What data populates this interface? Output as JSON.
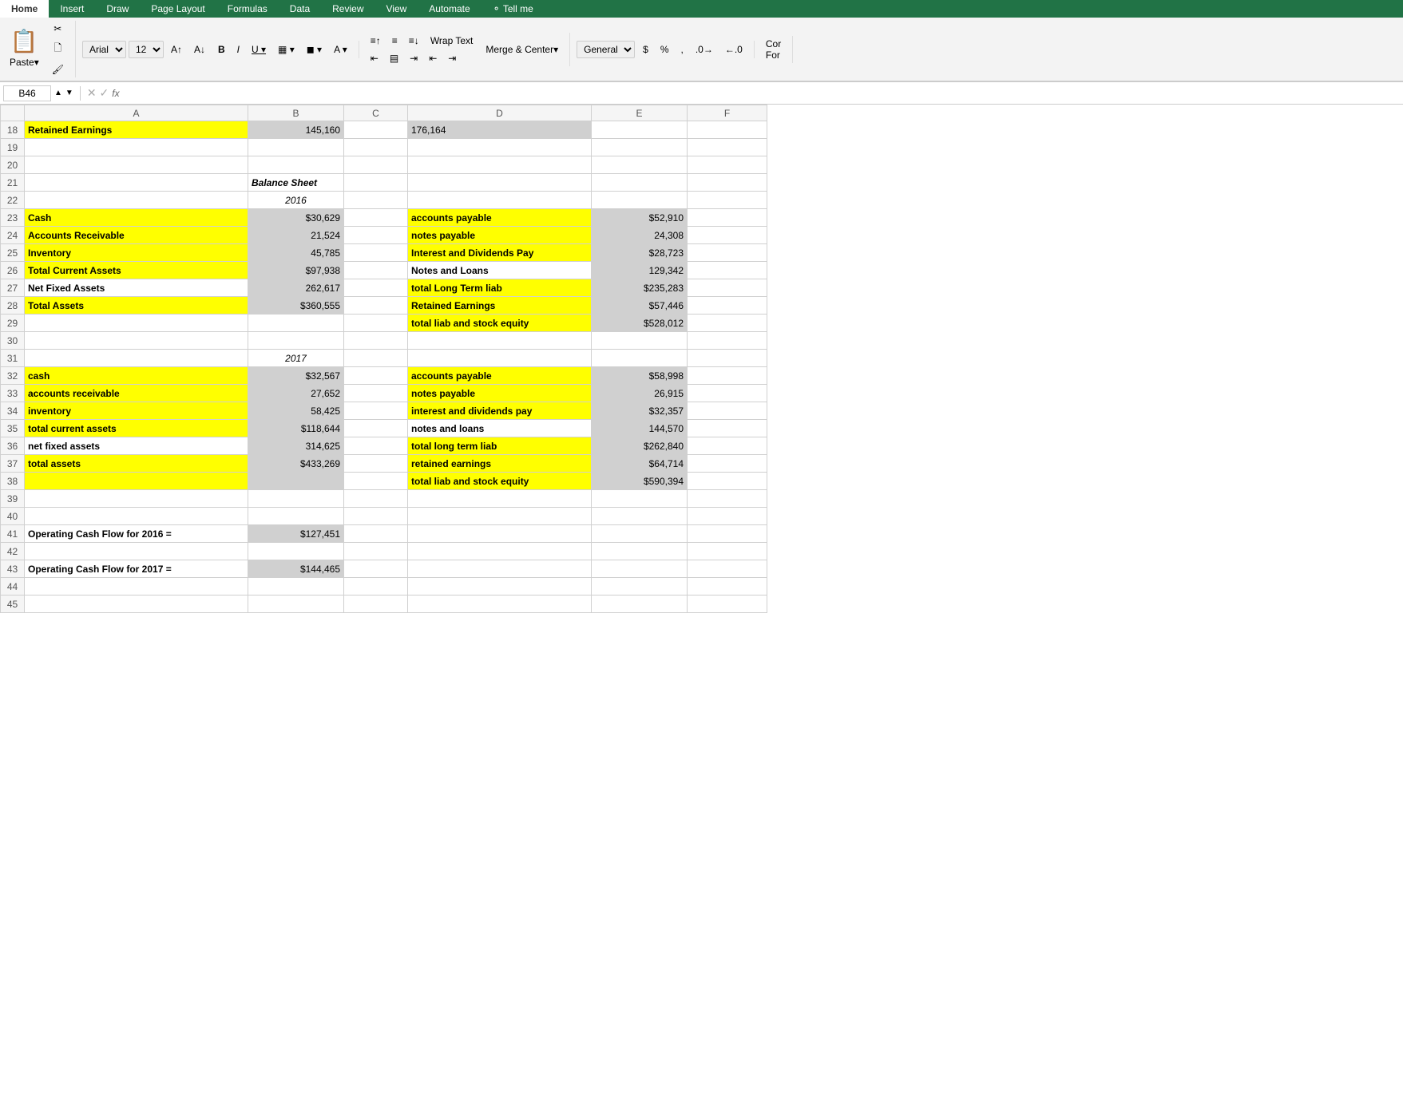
{
  "ribbon": {
    "tabs": [
      "Home",
      "Insert",
      "Draw",
      "Page Layout",
      "Formulas",
      "Data",
      "Review",
      "View",
      "Automate",
      "Tell me"
    ],
    "active_tab": "Home",
    "font_name": "Arial",
    "font_size": "12",
    "wrap_text": "Wrap Text",
    "merge_center": "Merge & Center",
    "format": "General",
    "paste_label": "Paste",
    "number_format_dollar": "$",
    "number_format_percent": "%",
    "number_format_comma": ","
  },
  "formula_bar": {
    "cell_ref": "B46",
    "fx": "fx"
  },
  "columns": {
    "headers": [
      "",
      "A",
      "B",
      "C",
      "D",
      "E",
      "F"
    ],
    "col_a_label": "A",
    "col_b_label": "B",
    "col_c_label": "C",
    "col_d_label": "D",
    "col_e_label": "E",
    "col_f_label": "F"
  },
  "rows": [
    {
      "num": 18,
      "a": "Retained Earnings",
      "b": "145,160",
      "c": "",
      "d": "176,164",
      "e": "",
      "a_yellow": true,
      "b_gray": true,
      "d_gray": true
    },
    {
      "num": 19,
      "a": "",
      "b": "",
      "c": "",
      "d": "",
      "e": ""
    },
    {
      "num": 20,
      "a": "",
      "b": "",
      "c": "",
      "d": "",
      "e": ""
    },
    {
      "num": 21,
      "a": "",
      "b": "Balance Sheet",
      "c": "",
      "d": "",
      "e": "",
      "b_italic_bold": true
    },
    {
      "num": 22,
      "a": "",
      "b": "2016",
      "c": "",
      "d": "",
      "e": "",
      "b_italic": true,
      "b_center": true
    },
    {
      "num": 23,
      "a": "Cash",
      "b": "$30,629",
      "c": "",
      "d": "accounts payable",
      "e": "$52,910",
      "a_yellow": true,
      "b_gray": true,
      "d_yellow": true,
      "e_gray": true
    },
    {
      "num": 24,
      "a": "Accounts Receivable",
      "b": "21,524",
      "c": "",
      "d": "notes payable",
      "e": "24,308",
      "a_yellow": true,
      "b_gray": true,
      "d_yellow": true,
      "e_gray": true
    },
    {
      "num": 25,
      "a": "Inventory",
      "b": "45,785",
      "c": "",
      "d": "Interest and Dividends Pay",
      "e": "$28,723",
      "a_yellow": true,
      "b_gray": true,
      "d_yellow": true,
      "e_gray": true
    },
    {
      "num": 26,
      "a": "Total Current Assets",
      "b": "$97,938",
      "c": "",
      "d": "Notes and Loans",
      "e": "129,342",
      "a_yellow": true,
      "b_gray": true,
      "d_plain": true,
      "e_gray": true
    },
    {
      "num": 27,
      "a": "Net Fixed Assets",
      "b": "262,617",
      "c": "",
      "d": "total Long Term liab",
      "e": "$235,283",
      "a_plain": true,
      "b_gray": true,
      "d_yellow": true,
      "e_gray": true
    },
    {
      "num": 28,
      "a": "Total Assets",
      "b": "$360,555",
      "c": "",
      "d": "Retained Earnings",
      "e": "$57,446",
      "a_yellow": true,
      "b_gray": true,
      "d_yellow": true,
      "e_gray": true
    },
    {
      "num": 29,
      "a": "",
      "b": "",
      "c": "",
      "d": "total liab and stock equity",
      "e": "$528,012",
      "d_yellow": true,
      "e_gray": true
    },
    {
      "num": 30,
      "a": "",
      "b": "",
      "c": "",
      "d": "",
      "e": ""
    },
    {
      "num": 31,
      "a": "",
      "b": "2017",
      "c": "",
      "d": "",
      "e": "",
      "b_italic": true,
      "b_center": true
    },
    {
      "num": 32,
      "a": "cash",
      "b": "$32,567",
      "c": "",
      "d": "accounts payable",
      "e": "$58,998",
      "a_yellow": true,
      "b_gray": true,
      "d_yellow": true,
      "e_gray": true
    },
    {
      "num": 33,
      "a": "accounts receivable",
      "b": "27,652",
      "c": "",
      "d": "notes payable",
      "e": "26,915",
      "a_yellow": true,
      "b_gray": true,
      "d_yellow": true,
      "e_gray": true
    },
    {
      "num": 34,
      "a": "inventory",
      "b": "58,425",
      "c": "",
      "d": "interest and dividends pay",
      "e": "$32,357",
      "a_yellow": true,
      "b_gray": true,
      "d_yellow": true,
      "e_gray": true
    },
    {
      "num": 35,
      "a": "total current assets",
      "b": "$118,644",
      "c": "",
      "d": "notes and loans",
      "e": "144,570",
      "a_yellow": true,
      "b_gray": true,
      "d_plain": true,
      "e_gray": true
    },
    {
      "num": 36,
      "a": "net fixed assets",
      "b": "314,625",
      "c": "",
      "d": "total long term liab",
      "e": "$262,840",
      "a_plain": true,
      "b_gray": true,
      "d_yellow": true,
      "e_gray": true
    },
    {
      "num": 37,
      "a": "total assets",
      "b": "$433,269",
      "c": "",
      "d": "retained earnings",
      "e": "$64,714",
      "a_yellow": true,
      "b_gray": true,
      "d_yellow": true,
      "e_gray": true
    },
    {
      "num": 38,
      "a": "",
      "b": "",
      "c": "",
      "d": "total liab and stock equity",
      "e": "$590,394",
      "a_yellow": true,
      "b_gray": true,
      "d_yellow": true,
      "e_gray": true
    },
    {
      "num": 39,
      "a": "",
      "b": "",
      "c": "",
      "d": "",
      "e": ""
    },
    {
      "num": 40,
      "a": "",
      "b": "",
      "c": "",
      "d": "",
      "e": ""
    },
    {
      "num": 41,
      "a": "Operating Cash Flow for 2016 =",
      "b": "$127,451",
      "c": "",
      "d": "",
      "e": "",
      "a_bold": true,
      "b_gray": true
    },
    {
      "num": 42,
      "a": "",
      "b": "",
      "c": "",
      "d": "",
      "e": ""
    },
    {
      "num": 43,
      "a": "Operating Cash Flow for 2017 =",
      "b": "$144,465",
      "c": "",
      "d": "",
      "e": "",
      "a_bold": true,
      "b_gray": true
    },
    {
      "num": 44,
      "a": "",
      "b": "",
      "c": "",
      "d": "",
      "e": ""
    },
    {
      "num": 45,
      "a": "",
      "b": "",
      "c": "",
      "d": "",
      "e": ""
    }
  ]
}
